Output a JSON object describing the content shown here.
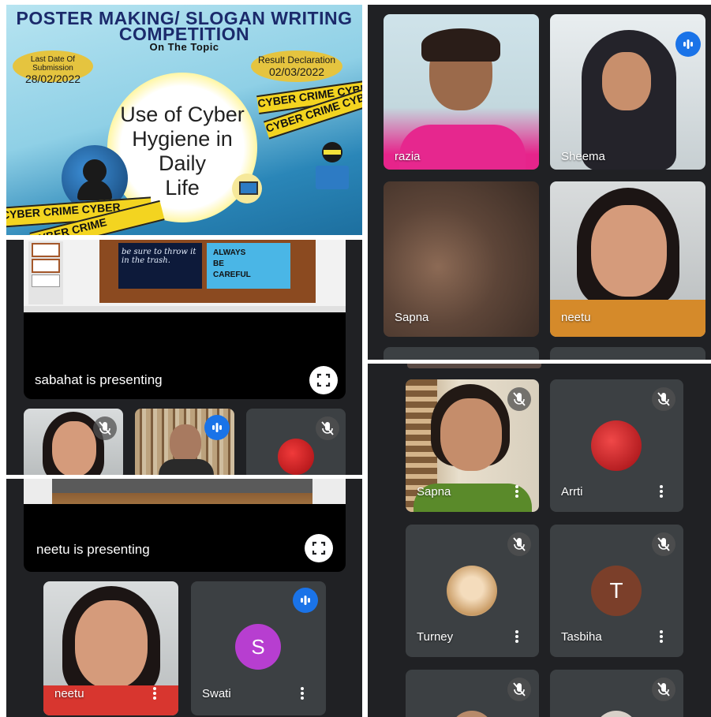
{
  "poster": {
    "title_line1": "POSTER MAKING/ SLOGAN WRITING",
    "title_line2": "COMPETITION",
    "subtitle": "On The Topic",
    "last_date_label": "Last Date Of Submission",
    "last_date": "28/02/2022",
    "result_label": "Result Declaration",
    "result_date": "02/03/2022",
    "topic_line1": "Use of Cyber",
    "topic_line2": "Hygiene in Daily",
    "topic_line3": "Life",
    "tape_text1": "CYBER CRIME CYBER CRIME",
    "tape_text2": "CYBER CRIME CYBER",
    "tape_text3": "CYBER CRIME CYBER",
    "tape_text4": "CYBER CRIME"
  },
  "grid_top_right": {
    "tiles": [
      {
        "name": "razia"
      },
      {
        "name": "Sheema"
      },
      {
        "name": "Sapna"
      },
      {
        "name": "neetu"
      }
    ]
  },
  "meeting_sabahat": {
    "presenting_text": "sabahat is presenting",
    "slide_text1": "be sure to throw it in the trash.",
    "slide_always": "ALWAYS",
    "slide_be": "BE",
    "slide_careful": "CAREFUL"
  },
  "meeting_neetu": {
    "presenting_text": "neetu is presenting",
    "tiles": [
      {
        "name": "neetu"
      },
      {
        "name": "Swati",
        "initial": "S"
      }
    ]
  },
  "grid_bottom_right": {
    "tiles": [
      {
        "name": "Sapna"
      },
      {
        "name": "Arrti"
      },
      {
        "name": "Turney"
      },
      {
        "name": "Tasbiha",
        "initial": "T"
      }
    ]
  },
  "colors": {
    "meet_bg": "#202124",
    "tile_bg": "#3c4043",
    "speak_blue": "#1a73e8",
    "swati_avatar": "#b73ed0",
    "tasbiha_avatar": "#7b3f2a"
  }
}
